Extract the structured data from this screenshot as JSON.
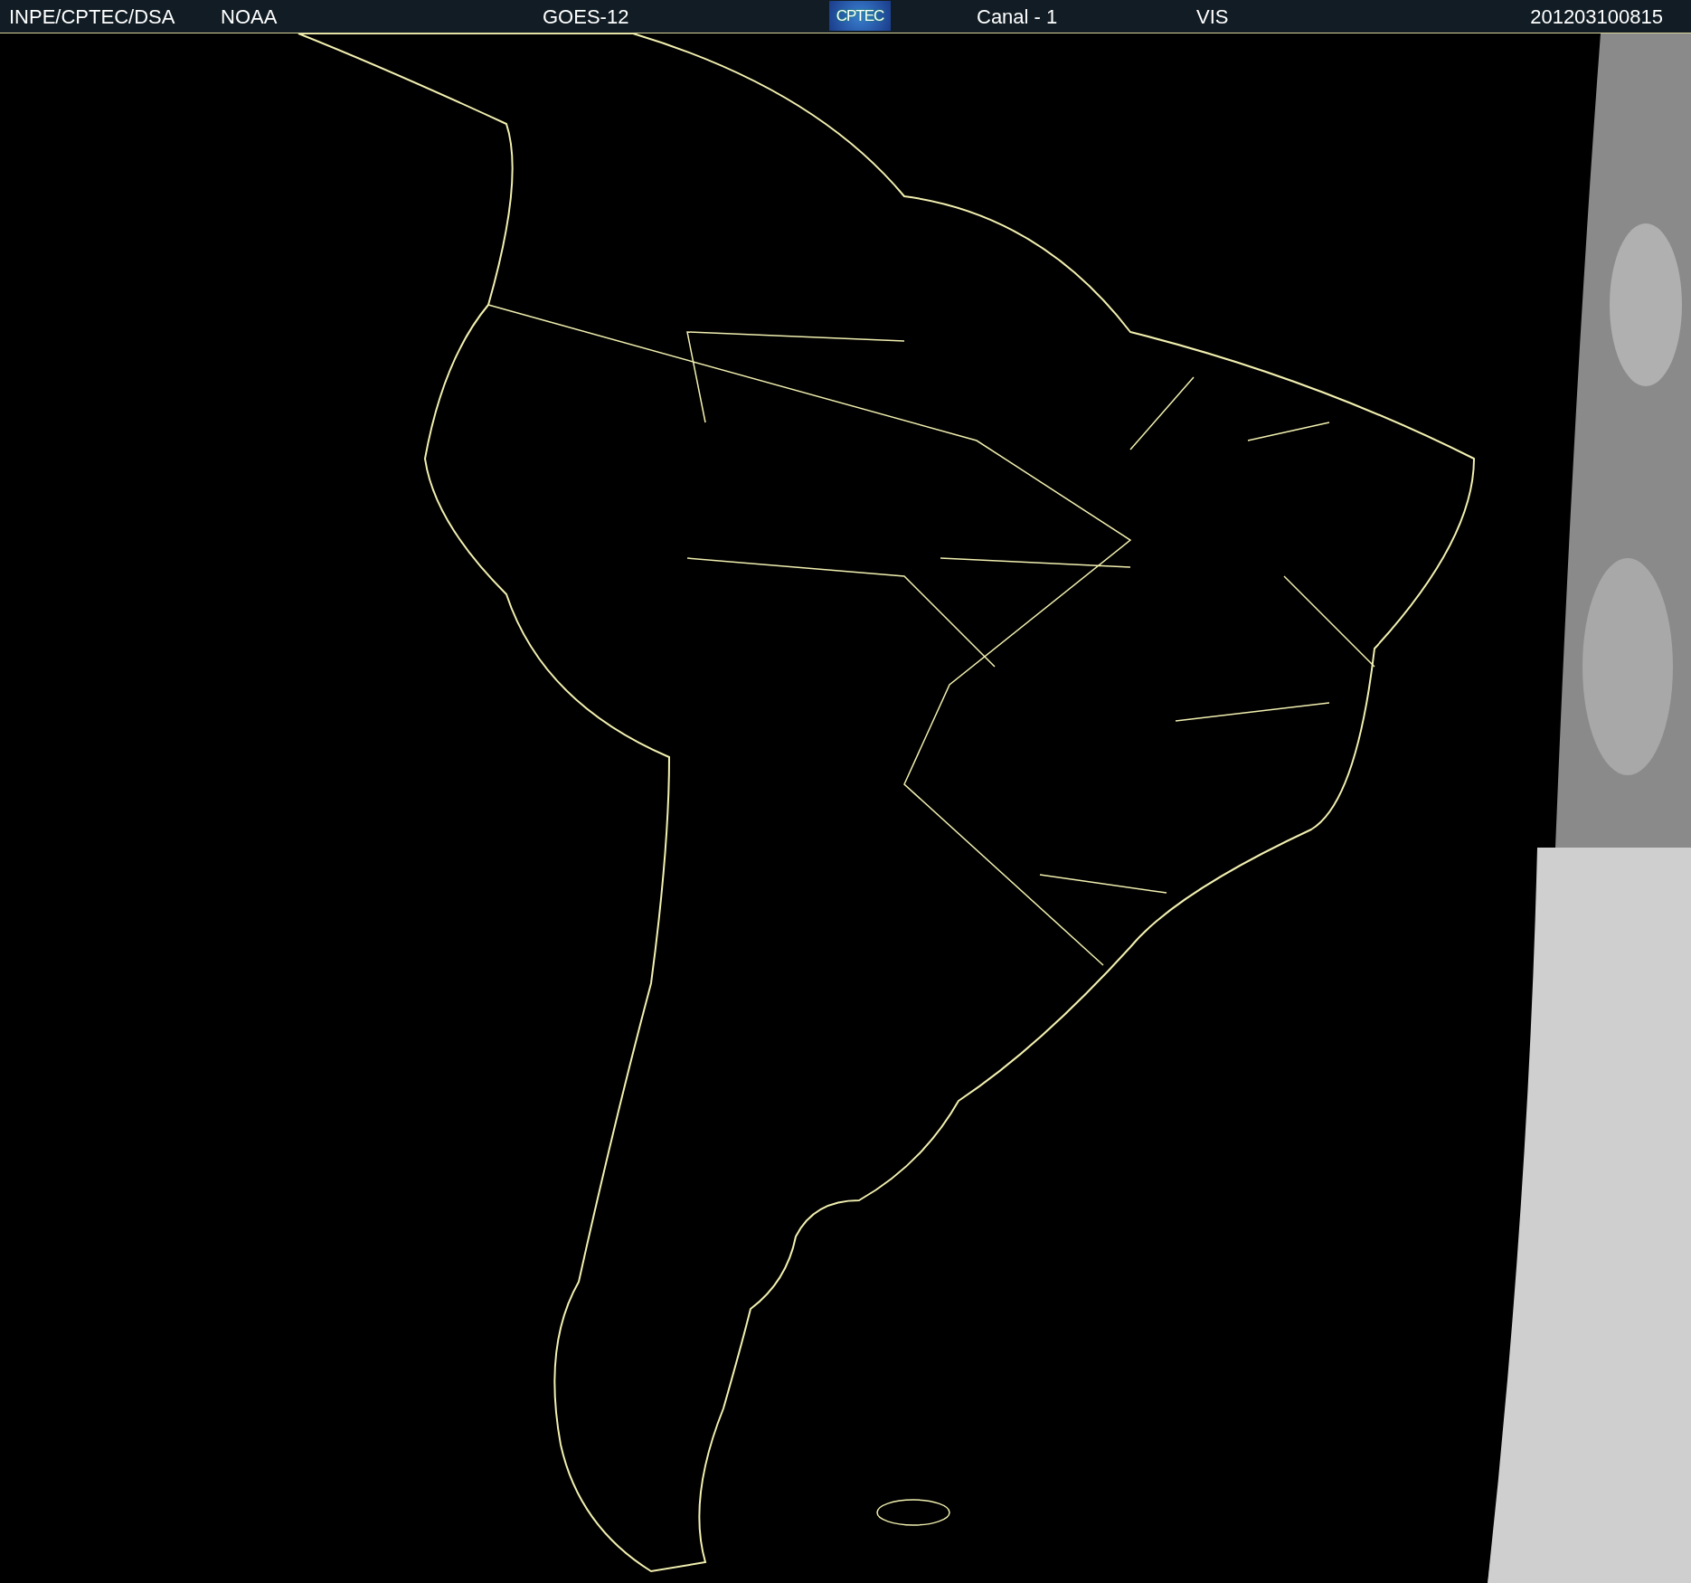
{
  "header": {
    "source": "INPE/CPTEC/DSA",
    "agency": "NOAA",
    "satellite": "GOES-12",
    "logo": "CPTEC",
    "channel": "Canal - 1",
    "band": "VIS",
    "timestamp": "201203100815"
  }
}
